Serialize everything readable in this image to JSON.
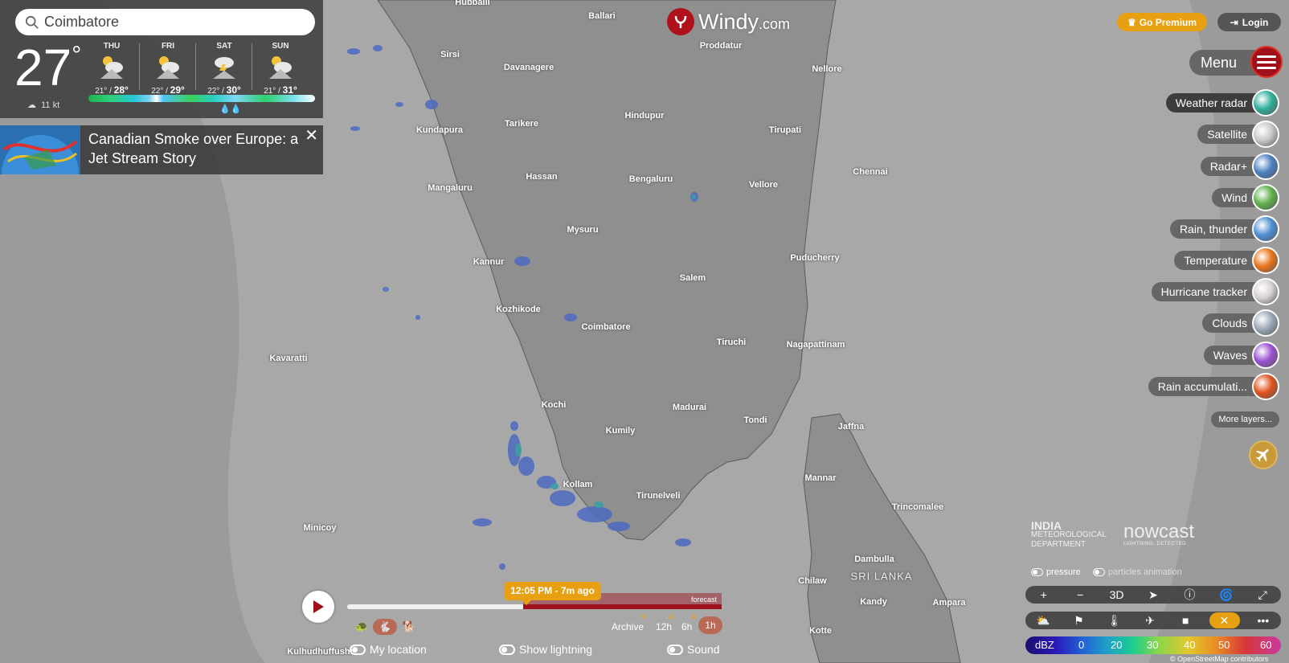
{
  "search": {
    "value": "Coimbatore"
  },
  "current": {
    "temp": "27",
    "degree": "°",
    "wind": "11 kt"
  },
  "days": [
    {
      "name": "THU",
      "low": "21°",
      "high": "28°"
    },
    {
      "name": "FRI",
      "low": "22°",
      "high": "29°"
    },
    {
      "name": "SAT",
      "low": "22°",
      "high": "30°"
    },
    {
      "name": "SUN",
      "low": "21°",
      "high": "31°"
    }
  ],
  "news": {
    "title": "Canadian Smoke over Europe: a Jet Stream Story",
    "close": "✕"
  },
  "logo": {
    "name": "Windy",
    "suffix": ".com"
  },
  "header": {
    "premium": "Go Premium",
    "login": "Login"
  },
  "menu": {
    "label": "Menu"
  },
  "layers": [
    {
      "label": "Weather radar",
      "icon": "weather-radar-thumb",
      "color": "#2fae9a"
    },
    {
      "label": "Satellite",
      "icon": "satellite-thumb",
      "color": "#c9c9c9"
    },
    {
      "label": "Radar+",
      "icon": "radar-plus-thumb",
      "color": "#4b7fbf"
    },
    {
      "label": "Wind",
      "icon": "wind-thumb",
      "color": "#5fb04a"
    },
    {
      "label": "Rain, thunder",
      "icon": "rain-thunder-thumb",
      "color": "#4d8ed1"
    },
    {
      "label": "Temperature",
      "icon": "temperature-thumb",
      "color": "#e8741a"
    },
    {
      "label": "Hurricane tracker",
      "icon": "hurricane-thumb",
      "color": "#d8d0d0"
    },
    {
      "label": "Clouds",
      "icon": "clouds-thumb",
      "color": "#9aa8b8"
    },
    {
      "label": "Waves",
      "icon": "waves-thumb",
      "color": "#9a4fd0"
    },
    {
      "label": "Rain accumulati...",
      "icon": "rain-accum-thumb",
      "color": "#e0521c"
    }
  ],
  "more_layers": "More layers...",
  "credits": {
    "imd_line1": "INDIA",
    "imd_line2": "METEOROLOGICAL",
    "imd_line3": "DEPARTMENT",
    "nowcast": "nowcast",
    "nowcast_sub": "LIGHTNING. DETECTED.",
    "osm": "© OpenStreetMap contributors"
  },
  "toggles": {
    "pressure": "pressure",
    "particles": "particles animation"
  },
  "toolbar1": {
    "zoom_in": "+",
    "zoom_out": "−",
    "three_d": "3D"
  },
  "scale": {
    "unit": "dBZ",
    "ticks": [
      "0",
      "20",
      "30",
      "40",
      "50",
      "60"
    ]
  },
  "timeline": {
    "current_time": "12:05 PM - 7m ago",
    "forecast": "forecast",
    "archive": "Archive",
    "steps": [
      "12h",
      "6h",
      "1h"
    ]
  },
  "bottom_toggles": {
    "my_location": "My location",
    "lightning": "Show lightning",
    "sound": "Sound"
  },
  "cities": [
    {
      "name": "Hubballi"
    },
    {
      "name": "Ballari"
    },
    {
      "name": "Proddatur"
    },
    {
      "name": "Sirsi"
    },
    {
      "name": "Davanagere"
    },
    {
      "name": "Nellore"
    },
    {
      "name": "Hindupur"
    },
    {
      "name": "Tarikere"
    },
    {
      "name": "Kundapura"
    },
    {
      "name": "Tirupati"
    },
    {
      "name": "Chennai"
    },
    {
      "name": "Hassan"
    },
    {
      "name": "Bengaluru"
    },
    {
      "name": "Vellore"
    },
    {
      "name": "Mangaluru"
    },
    {
      "name": "Mysuru"
    },
    {
      "name": "Kannur"
    },
    {
      "name": "Puducherry"
    },
    {
      "name": "Salem"
    },
    {
      "name": "Kozhikode"
    },
    {
      "name": "Coimbatore"
    },
    {
      "name": "Kavaratti"
    },
    {
      "name": "Tiruchi"
    },
    {
      "name": "Nagapattinam"
    },
    {
      "name": "Kochi"
    },
    {
      "name": "Madurai"
    },
    {
      "name": "Tondi"
    },
    {
      "name": "Jaffna"
    },
    {
      "name": "Kumily"
    },
    {
      "name": "Mannar"
    },
    {
      "name": "Kollam"
    },
    {
      "name": "Tirunelveli"
    },
    {
      "name": "Trincomalee"
    },
    {
      "name": "Minicoy"
    },
    {
      "name": "Dambulla"
    },
    {
      "name": "SRI LANKA"
    },
    {
      "name": "Chilaw"
    },
    {
      "name": "Kandy"
    },
    {
      "name": "Ampara"
    },
    {
      "name": "Kotte"
    },
    {
      "name": "Kulhudhuffushi"
    }
  ]
}
